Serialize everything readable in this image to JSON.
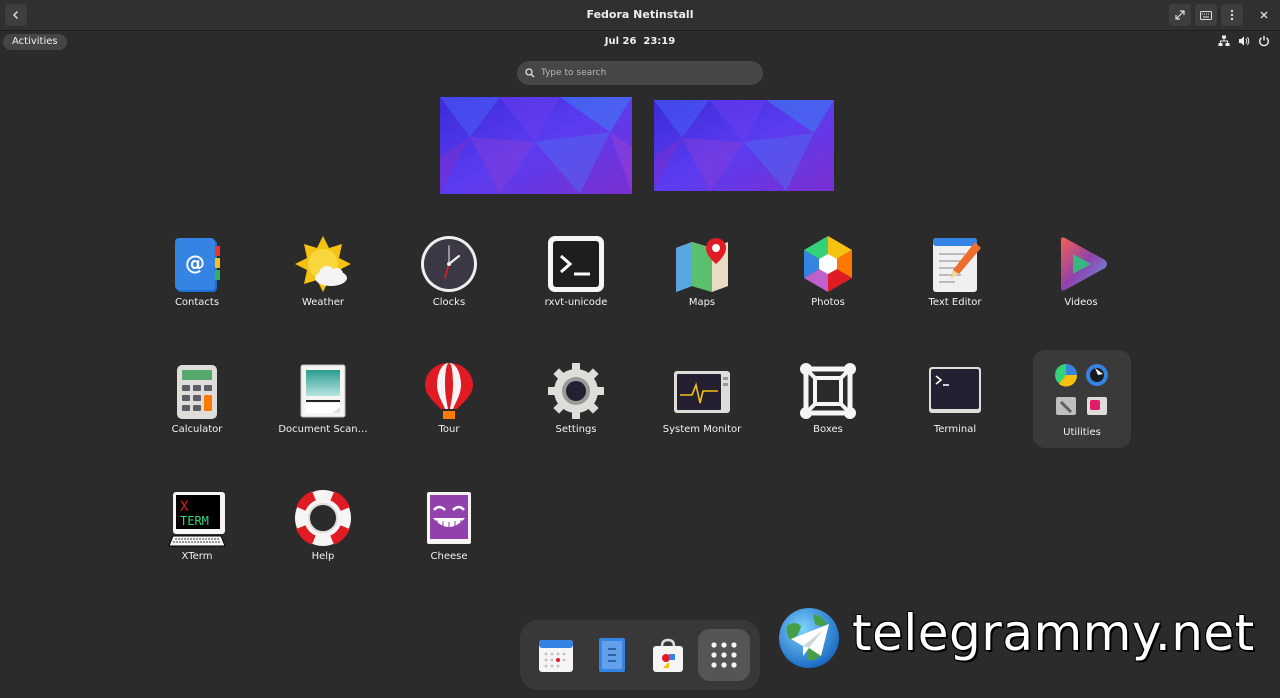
{
  "window": {
    "title": "Fedora Netinstall"
  },
  "topbar": {
    "activities": "Activities",
    "date": "Jul 26",
    "time": "23:19"
  },
  "search": {
    "placeholder": "Type to search"
  },
  "apps": [
    {
      "label": "Contacts",
      "icon": "contacts-icon"
    },
    {
      "label": "Weather",
      "icon": "weather-icon"
    },
    {
      "label": "Clocks",
      "icon": "clock-icon"
    },
    {
      "label": "rxvt-unicode",
      "icon": "terminal-icon"
    },
    {
      "label": "Maps",
      "icon": "map-icon"
    },
    {
      "label": "Photos",
      "icon": "photos-icon"
    },
    {
      "label": "Text Editor",
      "icon": "text-editor-icon"
    },
    {
      "label": "Videos",
      "icon": "play-icon"
    },
    {
      "label": "Calculator",
      "icon": "calculator-icon"
    },
    {
      "label": "Document Scan…",
      "icon": "scanner-icon"
    },
    {
      "label": "Tour",
      "icon": "balloon-icon"
    },
    {
      "label": "Settings",
      "icon": "gear-icon"
    },
    {
      "label": "System Monitor",
      "icon": "monitor-icon"
    },
    {
      "label": "Boxes",
      "icon": "boxes-icon"
    },
    {
      "label": "Terminal",
      "icon": "terminal-icon"
    },
    {
      "label": "Utilities",
      "icon": "folder-icon"
    },
    {
      "label": "XTerm",
      "icon": "xterm-icon"
    },
    {
      "label": "Help",
      "icon": "lifebuoy-icon"
    },
    {
      "label": "Cheese",
      "icon": "cheese-icon"
    }
  ],
  "xterm_icon_text": {
    "x": "X",
    "term": "TERM"
  },
  "dock": [
    "calendar-icon",
    "files-icon",
    "software-icon",
    "app-grid-icon"
  ],
  "watermark": "telegrammy.net",
  "colors": {
    "background": "#2b2b2b",
    "panel": "#303030",
    "search": "#464646",
    "dock": "#383838",
    "accent": "#3584e4"
  }
}
